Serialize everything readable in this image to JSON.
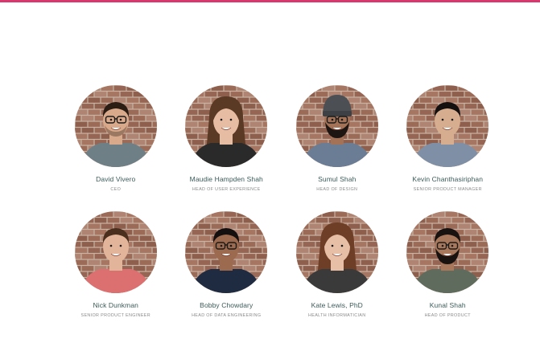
{
  "theme": {
    "accent": "#d9376e",
    "name_color": "#3a5a58",
    "role_color": "#8a8a8a",
    "brick_color": "#9c6b58",
    "mortar_color": "#c8b3a4"
  },
  "team": {
    "members": [
      {
        "name": "David Vivero",
        "role": "CEO",
        "photo": {
          "hair": "#2b1d14",
          "shirt": "#6f7f86",
          "skin": "#d8a98a",
          "glasses": true,
          "beard": "stubble",
          "beanie": null,
          "long_hair": false
        }
      },
      {
        "name": "Maudie Hampden Shah",
        "role": "Head of User Experience",
        "photo": {
          "hair": "#5a3a24",
          "shirt": "#2a2a2a",
          "skin": "#e6bca2",
          "glasses": false,
          "beard": null,
          "beanie": null,
          "long_hair": true
        }
      },
      {
        "name": "Sumul Shah",
        "role": "Head of Design",
        "photo": {
          "hair": "#1d1511",
          "shirt": "#6b7d95",
          "skin": "#a47357",
          "glasses": true,
          "beard": "full",
          "beanie": "#4c5055",
          "long_hair": false
        }
      },
      {
        "name": "Kevin Chanthasiriphan",
        "role": "Senior Product Manager",
        "photo": {
          "hair": "#141010",
          "shirt": "#7e8fa6",
          "skin": "#d6ad8e",
          "glasses": false,
          "beard": null,
          "beanie": null,
          "long_hair": false
        }
      },
      {
        "name": "Nick Dunkman",
        "role": "Senior Product Engineer",
        "photo": {
          "hair": "#4a2f1e",
          "shirt": "#dc6f70",
          "skin": "#e2b499",
          "glasses": false,
          "beard": null,
          "beanie": null,
          "long_hair": false
        }
      },
      {
        "name": "Bobby Chowdary",
        "role": "Head of Data Engineering",
        "photo": {
          "hair": "#141010",
          "shirt": "#1f2b40",
          "skin": "#9c6a4e",
          "glasses": true,
          "beard": null,
          "beanie": null,
          "long_hair": false
        }
      },
      {
        "name": "Kate Lewis, PhD",
        "role": "Health Informatician",
        "photo": {
          "hair": "#6e3f26",
          "shirt": "#3a3a3a",
          "skin": "#e6bfa6",
          "glasses": false,
          "beard": null,
          "beanie": null,
          "long_hair": true
        }
      },
      {
        "name": "Kunal Shah",
        "role": "Head of Product",
        "photo": {
          "hair": "#181210",
          "shirt": "#5f6b5c",
          "skin": "#a8785c",
          "glasses": true,
          "beard": "full",
          "beanie": null,
          "long_hair": false
        }
      }
    ]
  }
}
